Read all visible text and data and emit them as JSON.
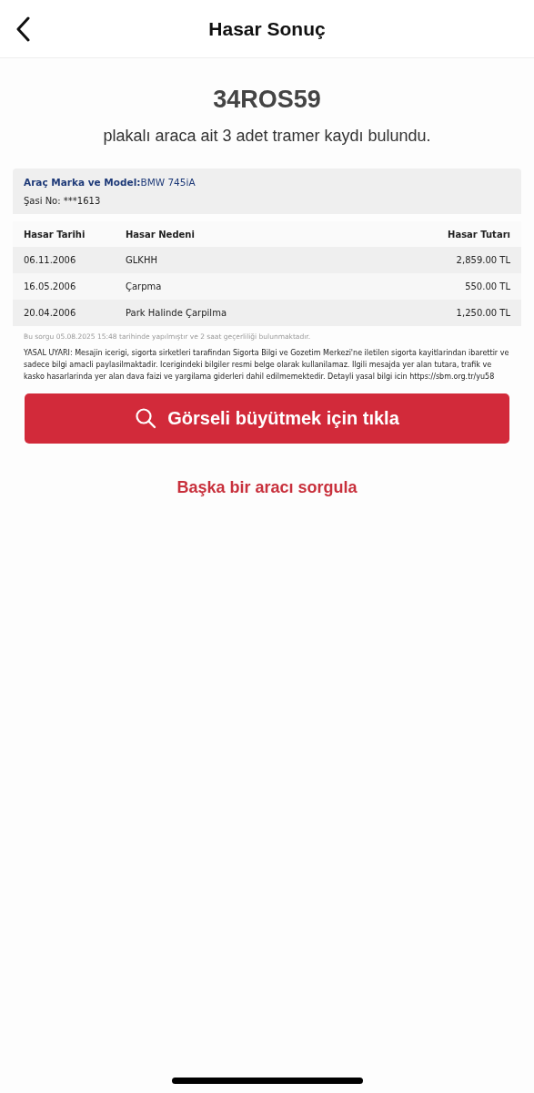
{
  "header": {
    "title": "Hasar Sonuç"
  },
  "plate": "34ROS59",
  "summary": "plakalı araca ait 3 adet tramer kaydı bulundu.",
  "vehicle": {
    "model_label": "Araç Marka ve Model:",
    "model_value": "BMW 745iA",
    "chassis": "Şasi No: ***1613"
  },
  "table": {
    "columns": [
      "Hasar Tarihi",
      "Hasar Nedeni",
      "Hasar Tutarı"
    ],
    "rows": [
      {
        "date": "06.11.2006",
        "reason": "GLKHH",
        "amount": "2,859.00 TL"
      },
      {
        "date": "16.05.2006",
        "reason": "Çarpma",
        "amount": "550.00 TL"
      },
      {
        "date": "20.04.2006",
        "reason": "Park Halinde Çarpilma",
        "amount": "1,250.00 TL"
      }
    ]
  },
  "query_note": "Bu sorgu 05.08.2025 15:48 tarihinde yapılmıştır ve 2 saat geçerliliği bulunmaktadır.",
  "legal": "YASAL UYARI: Mesajin icerigi, sigorta sirketleri tarafindan Sigorta Bilgi ve Gozetim Merkezi'ne iletilen sigorta kayitlarindan ibarettir ve sadece bilgi amacli paylasilmaktadir. Icerigindeki bilgiler resmi belge olarak kullanilamaz. Ilgili mesajda yer alan tutara, trafik ve kasko hasarlarinda yer alan dava faizi ve yargilama giderleri dahil edilmemektedir. Detayli yasal bilgi icin https://sbm.org.tr/yu58",
  "enlarge_button": "Görseli büyütmek için tıkla",
  "new_query_link": "Başka bir aracı sorgula"
}
